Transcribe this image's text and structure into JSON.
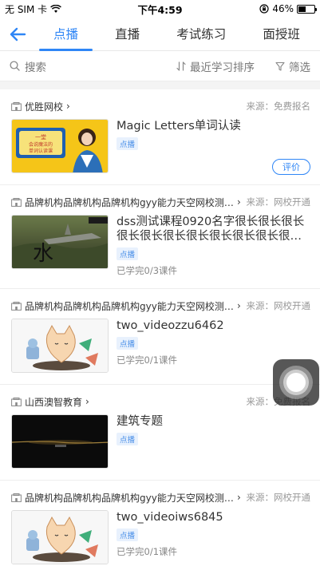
{
  "status": {
    "carrier": "无 SIM 卡",
    "time": "下午4:59",
    "battery": "46%",
    "battery_level": 0.46
  },
  "nav": {
    "tabs": [
      {
        "label": "点播",
        "active": true
      },
      {
        "label": "直播",
        "active": false
      },
      {
        "label": "考试练习",
        "active": false
      },
      {
        "label": "面授班",
        "active": false
      }
    ]
  },
  "filter": {
    "search": "搜索",
    "sort": "最近学习排序",
    "filter": "筛选"
  },
  "courses": [
    {
      "school": "优胜网校",
      "source": "来源：免费报名",
      "title": "Magic Letters单词认读",
      "badge": "点播",
      "progress": "",
      "action": "评价",
      "thumb_text": "一堂会说魔法的单词认读课"
    },
    {
      "school": "品牌机构品牌机构品牌机构gyy能力天空网校测试...",
      "source": "来源：网校开通",
      "title": "dss测试课程0920名字很长很长很长很长很长很长很长很长很长很长很长很...",
      "badge": "点播",
      "progress": "已学完0/3课件",
      "action": "",
      "thumb_text": ""
    },
    {
      "school": "品牌机构品牌机构品牌机构gyy能力天空网校测试...",
      "source": "来源：网校开通",
      "title": "two_videozzu6462",
      "badge": "点播",
      "progress": "已学完0/1课件",
      "action": "",
      "thumb_text": ""
    },
    {
      "school": "山西澳智教育",
      "source": "来源：免费报名",
      "title": "建筑专题",
      "badge": "点播",
      "progress": "",
      "action": "",
      "thumb_text": ""
    },
    {
      "school": "品牌机构品牌机构品牌机构gyy能力天空网校测试...",
      "source": "来源：网校开通",
      "title": "two_videoiws6845",
      "badge": "点播",
      "progress": "已学完0/1课件",
      "action": "",
      "thumb_text": ""
    }
  ],
  "colors": {
    "accent": "#2f86f6",
    "badge_bg": "#e8f1fd"
  }
}
